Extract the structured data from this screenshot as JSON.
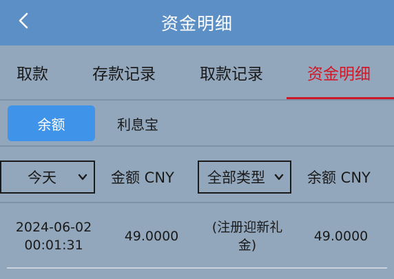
{
  "header": {
    "title": "资金明细",
    "back_icon": "chevron-left-icon"
  },
  "tabs": [
    {
      "label": "取款",
      "active": false
    },
    {
      "label": "存款记录",
      "active": false
    },
    {
      "label": "取款记录",
      "active": false
    },
    {
      "label": "资金明细",
      "active": true
    }
  ],
  "subtabs": [
    {
      "label": "余额",
      "active": true
    },
    {
      "label": "利息宝",
      "active": false
    }
  ],
  "filters": {
    "date_select": "今天",
    "amount_label": "金额 CNY",
    "type_select": "全部类型",
    "balance_label": "余额 CNY"
  },
  "rows": [
    {
      "date": "2024-06-02",
      "time": "00:01:31",
      "amount": "49.0000",
      "type_line1": "(注册迎新礼",
      "type_line2": "金)",
      "balance": "49.0000"
    }
  ],
  "colors": {
    "header_bg": "#5b8fc6",
    "page_bg": "#93a7bc",
    "active_tab": "#d01728",
    "active_subtab": "#3f93e8"
  }
}
